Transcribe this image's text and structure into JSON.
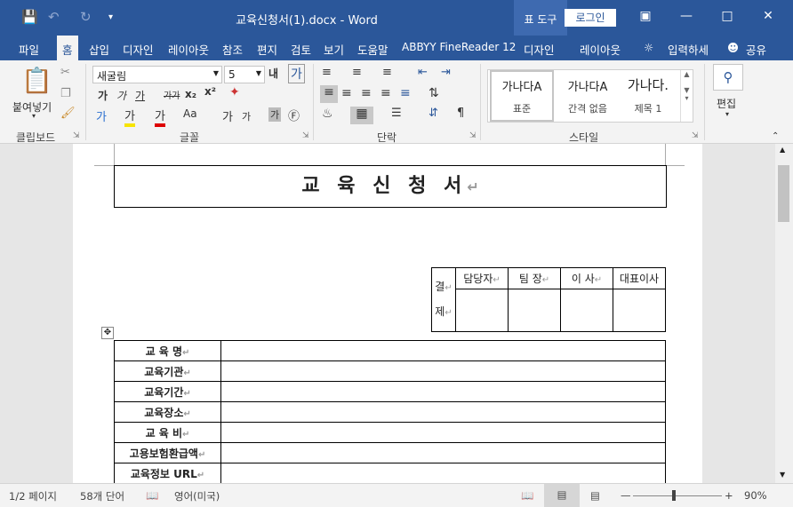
{
  "titlebar": {
    "document_title": "교육신청서(1).docx - Word",
    "context_group": "표 도구",
    "login": "로그인",
    "qa_save_icon": "save-icon",
    "qa_undo_icon": "undo-icon",
    "qa_redo_icon": "redo-icon"
  },
  "tabs": {
    "file": "파일",
    "home": "홈",
    "insert": "삽입",
    "design": "디자인",
    "layout": "레이아웃",
    "references": "참조",
    "mailings": "편지",
    "review": "검토",
    "view": "보기",
    "help": "도움말",
    "abbyy": "ABBYY FineReader 12",
    "table_design": "디자인",
    "table_layout": "레이아웃",
    "tell_me": "입력하세",
    "share": "공유"
  },
  "ribbon": {
    "paste": "붙여넣기",
    "font_name": "새굴림",
    "font_size": "5",
    "style_normal": "표준",
    "style_nospacing": "간격 없음",
    "style_heading1": "제목 1",
    "style_sample": "가나다A",
    "style_heading_sample": "가나다.",
    "edit": "편집",
    "groups": {
      "clipboard": "클립보드",
      "font": "글꼴",
      "paragraph": "단락",
      "styles": "스타일"
    }
  },
  "document": {
    "title": "교 육 신 청 서",
    "approval": {
      "side": [
        "결",
        "제"
      ],
      "roles": [
        "담당자",
        "팀 장",
        "이 사",
        "대표이사"
      ]
    },
    "rows": [
      "교 육 명",
      "교육기관",
      "교육기간",
      "교육장소",
      "교 육 비",
      "고용보험환급액",
      "교육정보 URL"
    ]
  },
  "status": {
    "page": "1/2 페이지",
    "words": "58개 단어",
    "language": "영어(미국)",
    "zoom": "90%"
  },
  "accent": "#2b579a"
}
